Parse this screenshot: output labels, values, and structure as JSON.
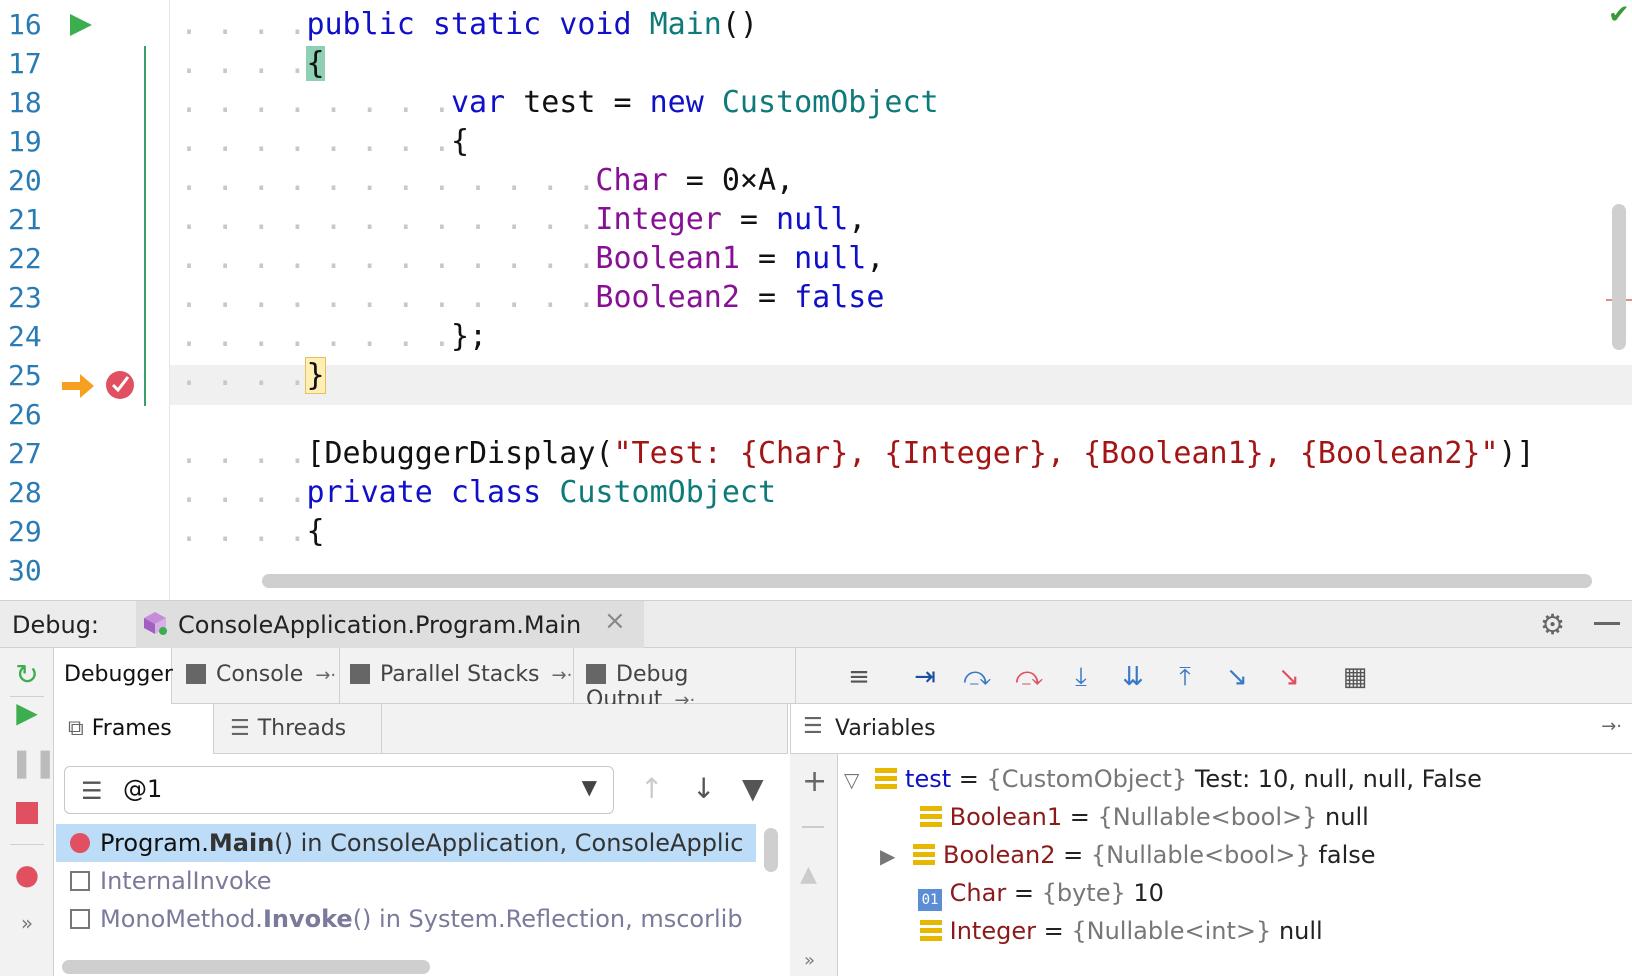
{
  "editor": {
    "line_numbers": [
      "16",
      "17",
      "18",
      "19",
      "20",
      "21",
      "22",
      "23",
      "24",
      "25",
      "26",
      "27",
      "28",
      "29",
      "30"
    ],
    "code": {
      "l16_kw": "public static void",
      "l16_name": "Main",
      "l16_rest": "()",
      "l17": "{",
      "l18_var": "var",
      "l18_name": "test",
      "l18_eq": "=",
      "l18_new": "new",
      "l18_type": "CustomObject",
      "l19": "{",
      "l20_prop": "Char",
      "l20_rest": "= 0×A,",
      "l21_prop": "Integer",
      "l21_eq": "=",
      "l21_val": "null",
      "l21_end": ",",
      "l22_prop": "Boolean1",
      "l22_eq": "=",
      "l22_val": "null",
      "l22_end": ",",
      "l23_prop": "Boolean2",
      "l23_eq": "=",
      "l23_val": "false",
      "l24": "};",
      "l25": "}",
      "l27_open": "[DebuggerDisplay(",
      "l27_str": "\"Test: {Char}, {Integer}, {Boolean1}, {Boolean2}\"",
      "l27_close": ")]",
      "l28_kw": "private class",
      "l28_type": "CustomObject",
      "l29": "{"
    }
  },
  "debug": {
    "label": "Debug:",
    "session_title": "ConsoleApplication.Program.Main",
    "tabs": [
      {
        "label": "Debugger"
      },
      {
        "label": "Console"
      },
      {
        "label": "Parallel Stacks"
      },
      {
        "label": "Debug Output"
      }
    ],
    "frames_tab": "Frames",
    "threads_tab": "Threads",
    "thread_value": "@1",
    "frames": [
      {
        "fn": "Program.",
        "fn_bold": "Main",
        "rest": "() in ConsoleApplication, ConsoleApplic"
      },
      {
        "fn": "InternalInvoke",
        "fn_bold": "",
        "rest": ""
      },
      {
        "fn": "MonoMethod.",
        "fn_bold": "Invoke",
        "rest": "() in System.Reflection, mscorlib"
      }
    ],
    "variables_label": "Variables",
    "variables": [
      {
        "name": "test",
        "eq": "=",
        "type": "{CustomObject}",
        "value": "Test: 10, null, null, False"
      },
      {
        "name": "Boolean1",
        "eq": "=",
        "type": "{Nullable<bool>}",
        "value": "null"
      },
      {
        "name": "Boolean2",
        "eq": "=",
        "type": "{Nullable<bool>}",
        "value": "false"
      },
      {
        "name": "Char",
        "eq": "=",
        "type": "{byte}",
        "value": "10"
      },
      {
        "name": "Integer",
        "eq": "=",
        "type": "{Nullable<int>}",
        "value": "null"
      }
    ],
    "char_icon_text": "01"
  }
}
